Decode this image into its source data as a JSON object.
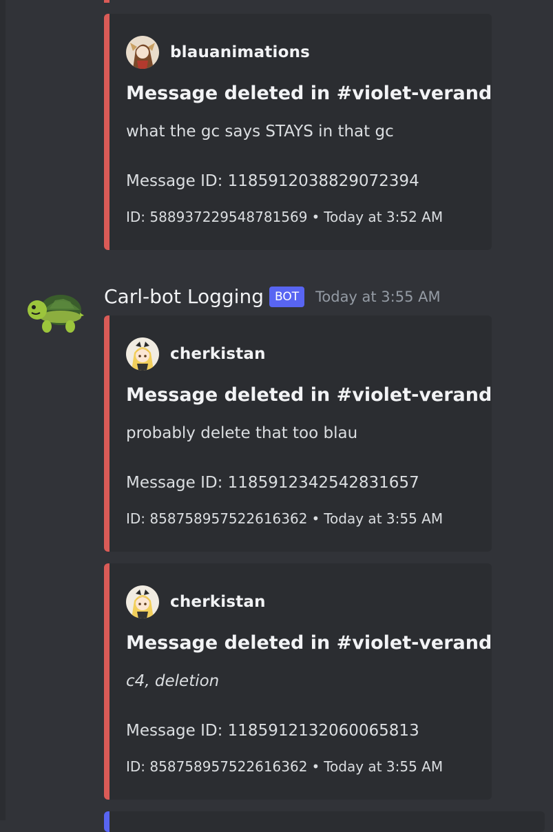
{
  "messages": [
    {
      "embeds": [
        {
          "author": "blauanimations",
          "title": "Message deleted in #violet-veranda",
          "content": "what the gc says STAYS in that gc",
          "message_id": "Message ID: 1185912038829072394",
          "footer_id": "ID: 588937229548781569",
          "footer_time": "Today at 3:52 AM"
        }
      ]
    },
    {
      "author_name": "Carl-bot Logging",
      "bot_tag": "BOT",
      "timestamp": "Today at 3:55 AM",
      "embeds": [
        {
          "author": "cherkistan",
          "title": "Message deleted in #violet-veranda",
          "content": "probably delete that too blau",
          "message_id": "Message ID: 1185912342542831657",
          "footer_id": "ID: 858758957522616362",
          "footer_time": "Today at 3:55 AM"
        },
        {
          "author": "cherkistan",
          "title": "Message deleted in #violet-veranda",
          "content": "c4, deletion",
          "message_id": "Message ID: 1185912132060065813",
          "footer_id": "ID: 858758957522616362",
          "footer_time": "Today at 3:55 AM"
        }
      ]
    }
  ],
  "footer_separator": "•",
  "colors": {
    "background": "#313338",
    "embed_background": "#2b2d31",
    "embed_bar_red": "#da5b57",
    "embed_bar_blue": "#5865f2",
    "bot_tag": "#5865f2",
    "timestamp": "#949ba4"
  },
  "icons": {
    "bot_avatar": "turtle-icon",
    "embed_avatar_1": "anime-avatar-brown",
    "embed_avatar_2": "anime-avatar-blonde"
  }
}
